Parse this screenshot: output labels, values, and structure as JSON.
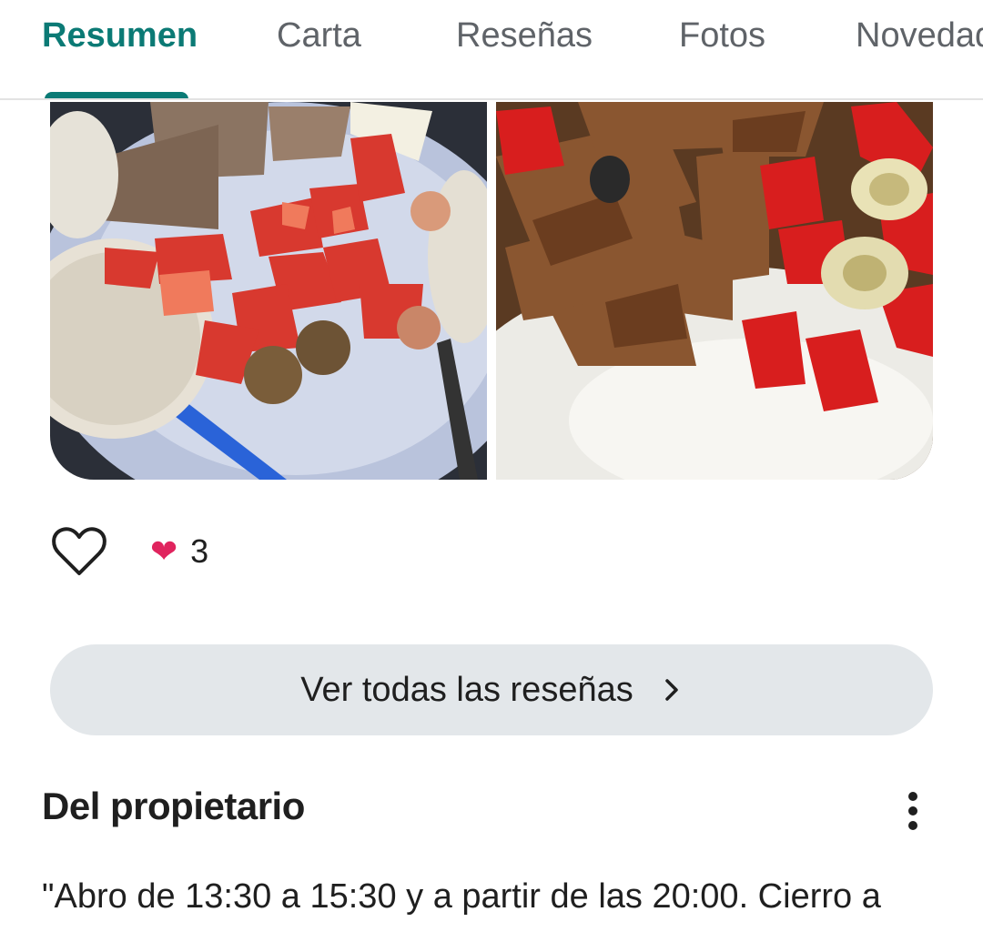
{
  "tabs": [
    {
      "label": "Resumen",
      "active": true
    },
    {
      "label": "Carta"
    },
    {
      "label": "Reseñas"
    },
    {
      "label": "Fotos"
    },
    {
      "label": "Novedades"
    }
  ],
  "photos": [
    {
      "icon": "food-photo-tomato-salad"
    },
    {
      "icon": "food-photo-meat-peppers"
    }
  ],
  "reactions": {
    "like_icon": "heart-outline-icon",
    "reaction_icon": "red-heart-emoji",
    "count": "3"
  },
  "all_reviews_button": {
    "label": "Ver todas las reseñas",
    "icon": "chevron-right-icon"
  },
  "owner_section": {
    "title": "Del propietario",
    "menu_icon": "more-vert-icon",
    "text": "\"Abro de 13:30 a 15:30 y a partir de las 20:00. Cierro a"
  },
  "colors": {
    "accent": "#0b7a75",
    "button_bg": "#e3e7ea",
    "heart": "#e0245e"
  }
}
